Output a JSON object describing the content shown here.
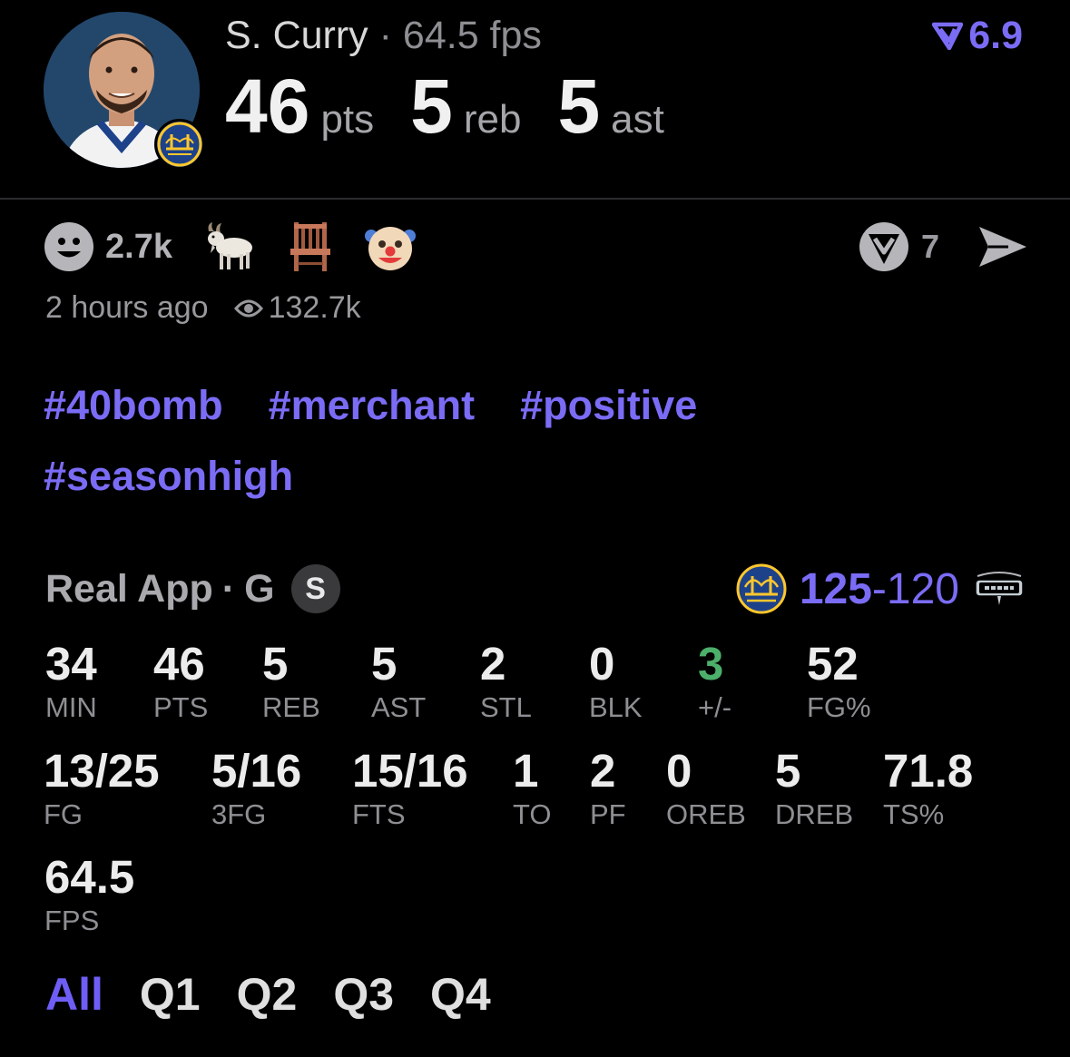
{
  "header": {
    "player_name": "S. Curry",
    "separator": "·",
    "fps_summary": "64.5 fps",
    "rating": "6.9",
    "points_value": "46",
    "points_unit": "pts",
    "rebounds_value": "5",
    "rebounds_unit": "reb",
    "assists_value": "5",
    "assists_unit": "ast"
  },
  "reactions": {
    "count": "2.7k",
    "emojis": [
      "smiley-icon",
      "goat-icon",
      "chair-icon",
      "clown-icon"
    ],
    "share_count": "7"
  },
  "meta": {
    "time_ago": "2 hours ago",
    "views": "132.7k"
  },
  "tags": [
    "#40bomb",
    "#merchant",
    "#positive",
    "#seasonhigh"
  ],
  "game": {
    "source": "Real App",
    "separator": "·",
    "position": "G",
    "badge": "S",
    "home_score": "125",
    "dash": "-",
    "away_score": "120"
  },
  "stats": [
    {
      "value": "34",
      "label": "MIN"
    },
    {
      "value": "46",
      "label": "PTS"
    },
    {
      "value": "5",
      "label": "REB"
    },
    {
      "value": "5",
      "label": "AST"
    },
    {
      "value": "2",
      "label": "STL"
    },
    {
      "value": "0",
      "label": "BLK"
    },
    {
      "value": "3",
      "label": "+/-"
    },
    {
      "value": "52",
      "label": "FG%"
    },
    {
      "value": "13/25",
      "label": "FG"
    },
    {
      "value": "5/16",
      "label": "3FG"
    },
    {
      "value": "15/16",
      "label": "FTS"
    },
    {
      "value": "1",
      "label": "TO"
    },
    {
      "value": "2",
      "label": "PF"
    },
    {
      "value": "0",
      "label": "OREB"
    },
    {
      "value": "5",
      "label": "DREB"
    },
    {
      "value": "71.8",
      "label": "TS%"
    },
    {
      "value": "64.5",
      "label": "FPS"
    }
  ],
  "tabs": [
    "All",
    "Q1",
    "Q2",
    "Q3",
    "Q4"
  ],
  "colors": {
    "accent": "#7b6cf6",
    "positive": "#4caf6a",
    "background": "#000000"
  }
}
